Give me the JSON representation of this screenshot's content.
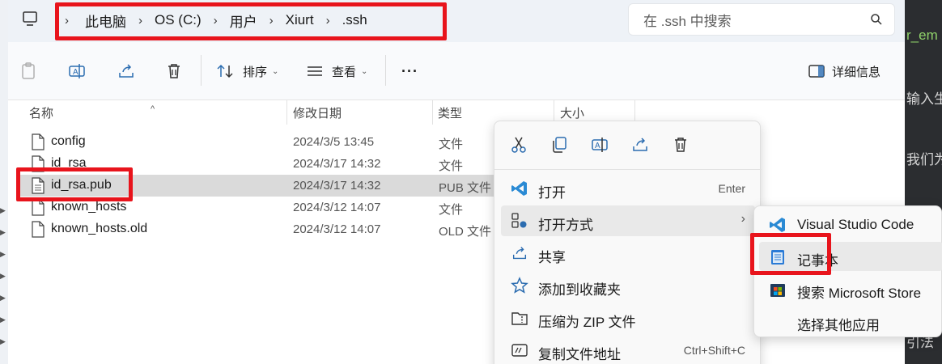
{
  "breadcrumb": [
    "此电脑",
    "OS (C:)",
    "用户",
    "Xiurt",
    ".ssh"
  ],
  "search": {
    "placeholder": "在 .ssh 中搜索"
  },
  "toolbar": {
    "sort_label": "排序",
    "view_label": "查看",
    "more_label": "···",
    "details_label": "详细信息"
  },
  "columns": {
    "name": "名称",
    "date": "修改日期",
    "type": "类型",
    "size": "大小"
  },
  "files": [
    {
      "name": "config",
      "date": "2024/3/5 13:45",
      "type": "文件"
    },
    {
      "name": "id_rsa",
      "date": "2024/3/17 14:32",
      "type": "文件"
    },
    {
      "name": "id_rsa.pub",
      "date": "2024/3/17 14:32",
      "type": "PUB 文件"
    },
    {
      "name": "known_hosts",
      "date": "2024/3/12 14:07",
      "type": "文件"
    },
    {
      "name": "known_hosts.old",
      "date": "2024/3/12 14:07",
      "type": "OLD 文件"
    }
  ],
  "context_menu": {
    "icons": [
      "cut-icon",
      "copy-icon",
      "rename-icon",
      "share-icon",
      "delete-icon"
    ],
    "items": [
      {
        "label": "打开",
        "shortcut": "Enter"
      },
      {
        "label": "打开方式",
        "shortcut": ""
      },
      {
        "label": "共享",
        "shortcut": ""
      },
      {
        "label": "添加到收藏夹",
        "shortcut": ""
      },
      {
        "label": "压缩为 ZIP 文件",
        "shortcut": ""
      },
      {
        "label": "复制文件地址",
        "shortcut": "Ctrl+Shift+C"
      }
    ]
  },
  "submenu": {
    "items": [
      {
        "label": "Visual Studio Code"
      },
      {
        "label": "记事本"
      },
      {
        "label": "搜索 Microsoft Store"
      },
      {
        "label": "选择其他应用"
      }
    ]
  },
  "editor_strip": {
    "top_text": "r_em",
    "lines": [
      "输入生",
      "我们为",
      "引法"
    ]
  },
  "colors": {
    "highlight": "#e8141c",
    "selected_row": "#dadada",
    "vscode_blue": "#2a8ad4"
  }
}
